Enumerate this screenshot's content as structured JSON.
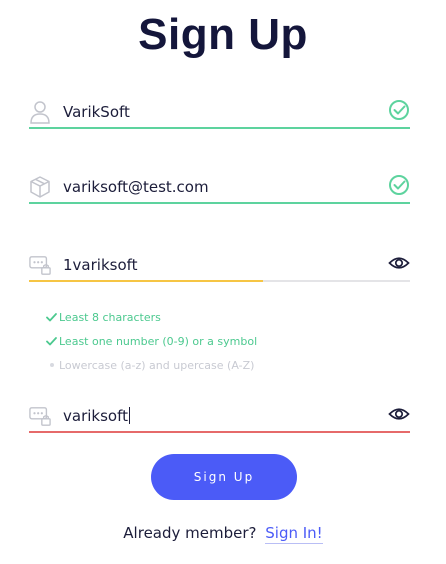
{
  "title": "Sign Up",
  "fields": {
    "name": {
      "value": "VarikSoft",
      "status": "valid"
    },
    "email": {
      "value": "variksoft@test.com",
      "status": "valid"
    },
    "password": {
      "value": "1variksoft",
      "strength": 0.615
    },
    "confirm": {
      "value": "variksoft",
      "status": "error"
    }
  },
  "password_rules": [
    {
      "label": "Least 8 characters",
      "met": true
    },
    {
      "label": "Least one number (0-9) or a symbol",
      "met": true
    },
    {
      "label": "Lowercase (a-z) and upercase (A-Z)",
      "met": false
    }
  ],
  "signup_button": {
    "label": "Sign Up"
  },
  "footer": {
    "text": "Already member?",
    "link": "Sign In!"
  },
  "colors": {
    "title": "#14163b",
    "valid": "#5dd39e",
    "error": "#e66a6a",
    "strength": "#f6c544",
    "primary": "#4b5bf7"
  },
  "icons": [
    "user-icon",
    "box-icon",
    "password-icon",
    "check-circle-icon",
    "eye-icon"
  ]
}
